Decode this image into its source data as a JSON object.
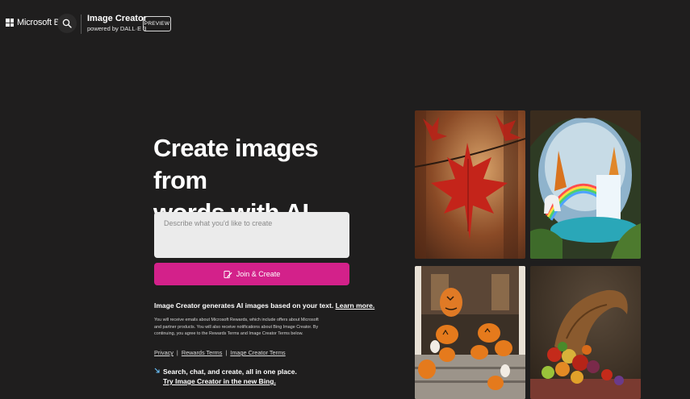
{
  "header": {
    "brand": "Microsoft Bing",
    "product_title": "Image Creator",
    "product_subtitle": "powered by DALL·E 3",
    "preview_badge": "PREVIEW",
    "search_icon": "search-icon"
  },
  "hero": {
    "title_line1": "Create images from",
    "title_line2": "words with AI",
    "prompt_placeholder": "Describe what you'd like to create",
    "join_button": "Join & Create",
    "join_icon": "pen-edit-icon",
    "accent": "#d3218a"
  },
  "info": {
    "text": "Image Creator generates AI images based on your text.",
    "learn_more": "Learn more.",
    "fine_print": "You will receive emails about Microsoft Rewards, which include offers about Microsoft and partner products. You will also receive notifications about Bing Image Creator. By continuing, you agree to the Rewards Terms and Image Creator Terms below."
  },
  "links": {
    "privacy": "Privacy",
    "sep1": "|",
    "rewards_terms": "Rewards Terms",
    "sep2": "|",
    "image_creator_terms": "Image Creator Terms"
  },
  "promo": {
    "line1": "Search, chat, and create, all in one place.",
    "line2": "Try Image Creator in the new Bing.",
    "icon": "arrow-icon"
  },
  "gallery": {
    "images": [
      "maple-leaf-image",
      "waterfall-unicorn-image",
      "pumpkin-porch-image",
      "cornucopia-image"
    ]
  }
}
